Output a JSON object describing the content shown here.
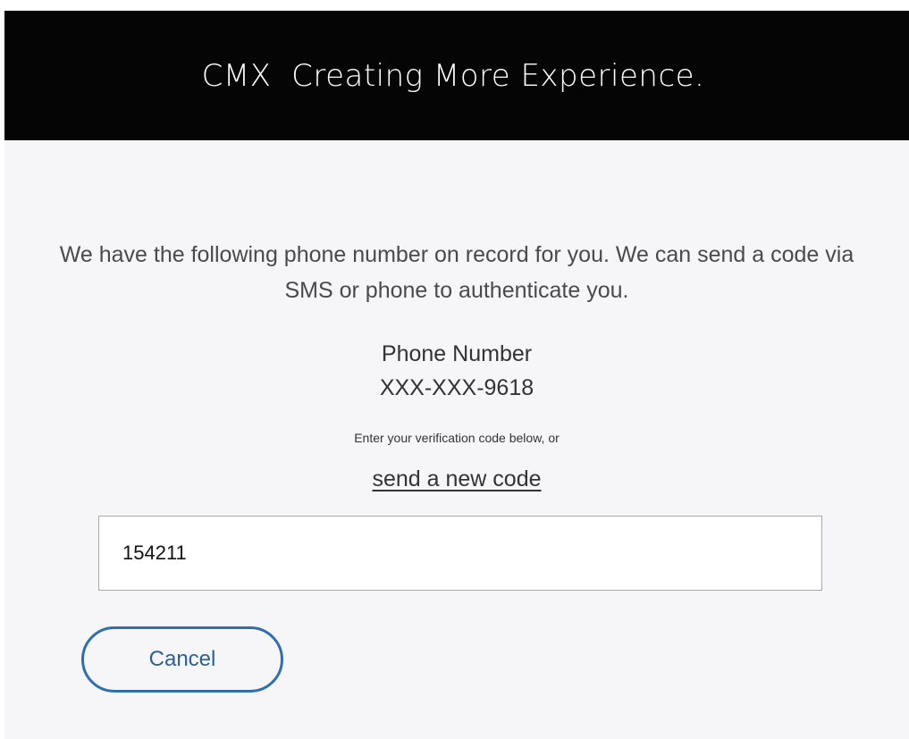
{
  "header": {
    "title": "CMX  Creating More Experience."
  },
  "info": {
    "message": "We have the following phone number on record for you. We can send a code via SMS or phone to authenticate you."
  },
  "phone": {
    "label": "Phone Number",
    "number": "XXX-XXX-9618"
  },
  "verification": {
    "hint": "Enter your verification code below, or",
    "new_code_link": "send a new code",
    "code_value": "154211"
  },
  "actions": {
    "cancel_label": "Cancel"
  },
  "colors": {
    "header_bg": "#050505",
    "page_bg": "#f6f6f8",
    "button_border": "#2f6fb0"
  }
}
